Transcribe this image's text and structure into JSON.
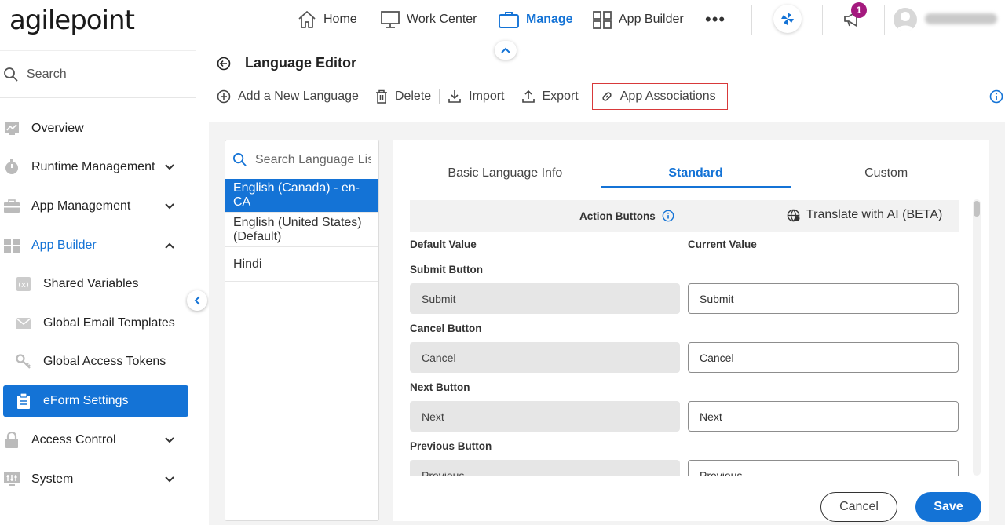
{
  "header": {
    "logo": "agilepoint",
    "nav": [
      {
        "label": "Home",
        "icon": "home-icon"
      },
      {
        "label": "Work Center",
        "icon": "monitor-icon"
      },
      {
        "label": "Manage",
        "icon": "briefcase-icon",
        "active": true
      },
      {
        "label": "App Builder",
        "icon": "grid-icon"
      }
    ],
    "more": "•••",
    "notification_count": "1",
    "username": "username"
  },
  "sidebar": {
    "search_placeholder": "Search",
    "items": [
      {
        "label": "Overview",
        "icon": "chart-icon"
      },
      {
        "label": "Runtime Management",
        "icon": "timer-icon"
      },
      {
        "label": "App Management",
        "icon": "briefcase-icon"
      },
      {
        "label": "App Builder",
        "icon": "grid-icon"
      },
      {
        "label": "Shared Variables",
        "icon": "variable-icon"
      },
      {
        "label": "Global Email Templates",
        "icon": "mail-icon"
      },
      {
        "label": "Global Access Tokens",
        "icon": "key-icon"
      },
      {
        "label": "eForm Settings",
        "icon": "clipboard-icon"
      },
      {
        "label": "Access Control",
        "icon": "lock-icon"
      },
      {
        "label": "System",
        "icon": "settings-icon"
      }
    ]
  },
  "page": {
    "title": "Language Editor",
    "toolbar": {
      "add": "Add a New Language",
      "delete": "Delete",
      "import": "Import",
      "export": "Export",
      "app_associations": "App Associations"
    }
  },
  "languages": {
    "search_placeholder": "Search Language List",
    "items": [
      "English (Canada) - en-CA",
      "English (United States) (Default)",
      "Hindi"
    ]
  },
  "editor": {
    "tabs": [
      "Basic Language Info",
      "Standard",
      "Custom"
    ],
    "section_title": "Action Buttons",
    "translate": "Translate with AI (BETA)",
    "col_default": "Default Value",
    "col_current": "Current Value",
    "fields": [
      {
        "label": "Submit Button",
        "default": "Submit",
        "current": "Submit"
      },
      {
        "label": "Cancel Button",
        "default": "Cancel",
        "current": "Cancel"
      },
      {
        "label": "Next Button",
        "default": "Next",
        "current": "Next"
      },
      {
        "label": "Previous Button",
        "default": "Previous",
        "current": "Previous"
      }
    ],
    "cancel": "Cancel",
    "save": "Save"
  },
  "colors": {
    "accent": "#1473d6",
    "badge": "#a4197e",
    "highlight": "#d8393a"
  }
}
